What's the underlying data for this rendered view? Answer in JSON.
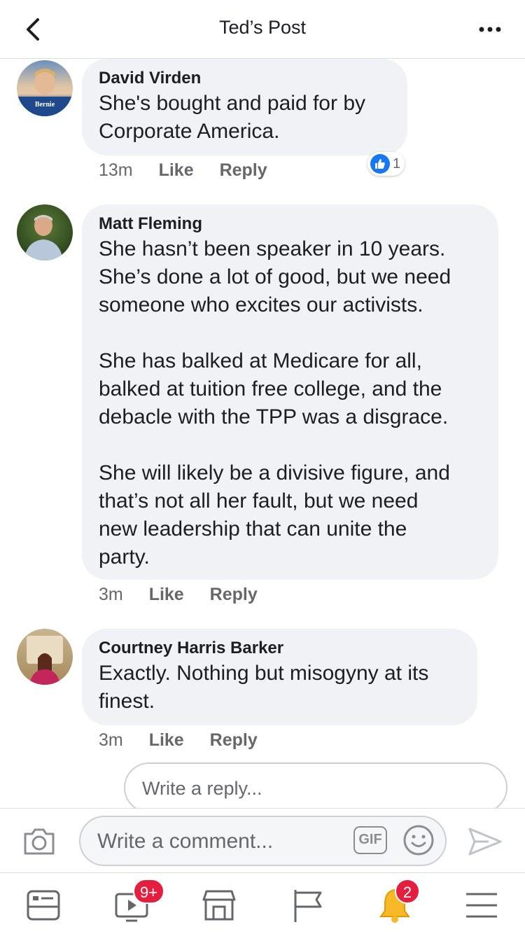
{
  "header": {
    "title": "Ted’s Post",
    "back_icon": "chevron-left-icon",
    "more_icon": "more-dots-icon"
  },
  "comments": [
    {
      "author": "David Virden",
      "text": "She's bought and paid for by\nCorporate America.",
      "time": "13m",
      "like_label": "Like",
      "reply_label": "Reply",
      "reaction_count": "1",
      "avatar_caption": "Bernie"
    },
    {
      "author": "Matt Fleming",
      "text": "She hasn’t been speaker in 10 years.\nShe’s done a lot of good, but we need\nsomeone who excites our activists.\n\nShe has balked at Medicare for all,\nbalked at tuition free college, and the\ndebacle with the TPP was a disgrace.\n\nShe will likely be a divisive figure, and\nthat’s not all her fault, but we need\nnew leadership that can unite the\nparty.",
      "time": "3m",
      "like_label": "Like",
      "reply_label": "Reply"
    },
    {
      "author": "Courtney Harris Barker",
      "text": "Exactly. Nothing but misogyny at its\nfinest.",
      "time": "3m",
      "like_label": "Like",
      "reply_label": "Reply"
    }
  ],
  "reply_box": {
    "placeholder": "Write a reply..."
  },
  "composer": {
    "placeholder": "Write a comment...",
    "gif_label": "GIF"
  },
  "tabbar": {
    "video_badge": "9+",
    "notifications_badge": "2"
  },
  "colors": {
    "accent": "#1877f2",
    "badge": "#e41e3f",
    "bubble": "#f0f2f5",
    "muted_text": "#65676b"
  }
}
